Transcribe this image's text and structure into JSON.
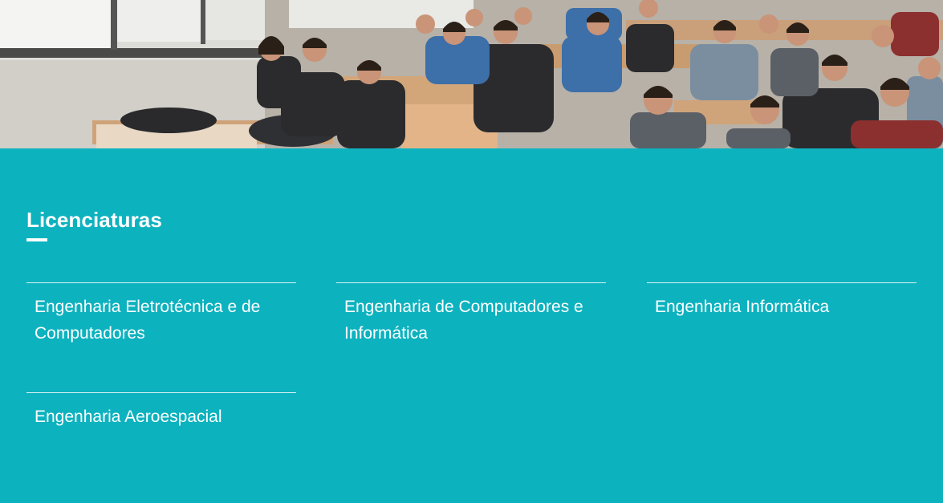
{
  "hero": {
    "image": "classroom-students-photo"
  },
  "section": {
    "title": "Licenciaturas",
    "courses": [
      {
        "label": "Engenharia Eletrotécnica e de Computadores"
      },
      {
        "label": "Engenharia de Computadores e Informática"
      },
      {
        "label": "Engenharia Informática"
      },
      {
        "label": "Engenharia Aeroespacial"
      }
    ]
  },
  "colors": {
    "section_background": "#0db2bf",
    "text": "#ffffff"
  }
}
